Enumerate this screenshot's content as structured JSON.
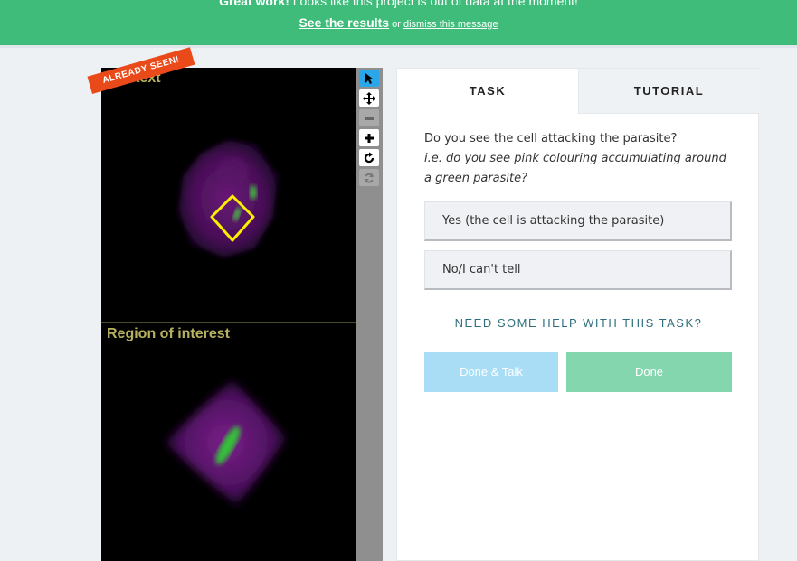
{
  "banner": {
    "bold_text": "Great work!",
    "message": "Looks like this project is out of data at the moment!",
    "results_link": "See the results",
    "or_text": "or",
    "dismiss_link": "dismiss this message"
  },
  "viewer": {
    "badge": "ALREADY SEEN!",
    "context_label": "Context",
    "roi_label": "Region of interest"
  },
  "toolbar": {
    "tools": [
      {
        "icon": "pointer-icon",
        "glyph": "➤"
      },
      {
        "icon": "move-icon",
        "glyph": "✥"
      },
      {
        "icon": "zoom-out-icon",
        "glyph": "−"
      },
      {
        "icon": "zoom-in-icon",
        "glyph": "+"
      },
      {
        "icon": "rotate-icon",
        "glyph": "↻"
      },
      {
        "icon": "reset-icon",
        "glyph": "⟳"
      }
    ]
  },
  "panel": {
    "tabs": [
      {
        "label": "TASK",
        "active": true
      },
      {
        "label": "TUTORIAL",
        "active": false
      }
    ],
    "question": "Do you see the cell attacking the parasite?",
    "hint": "i.e. do you see pink colouring accumulating around a green parasite?",
    "answers": [
      "Yes (the cell is attacking the parasite)",
      "No/I can't tell"
    ],
    "help_link": "NEED SOME HELP WITH THIS TASK?",
    "done_talk_label": "Done & Talk",
    "done_label": "Done"
  },
  "colors": {
    "banner": "#3fbc7a",
    "badge": "#ea4a1a",
    "active_tool": "#2aa7e8",
    "done_talk": "#a9ddf6",
    "done": "#84d6ae",
    "help_link": "#2c6e7e"
  }
}
